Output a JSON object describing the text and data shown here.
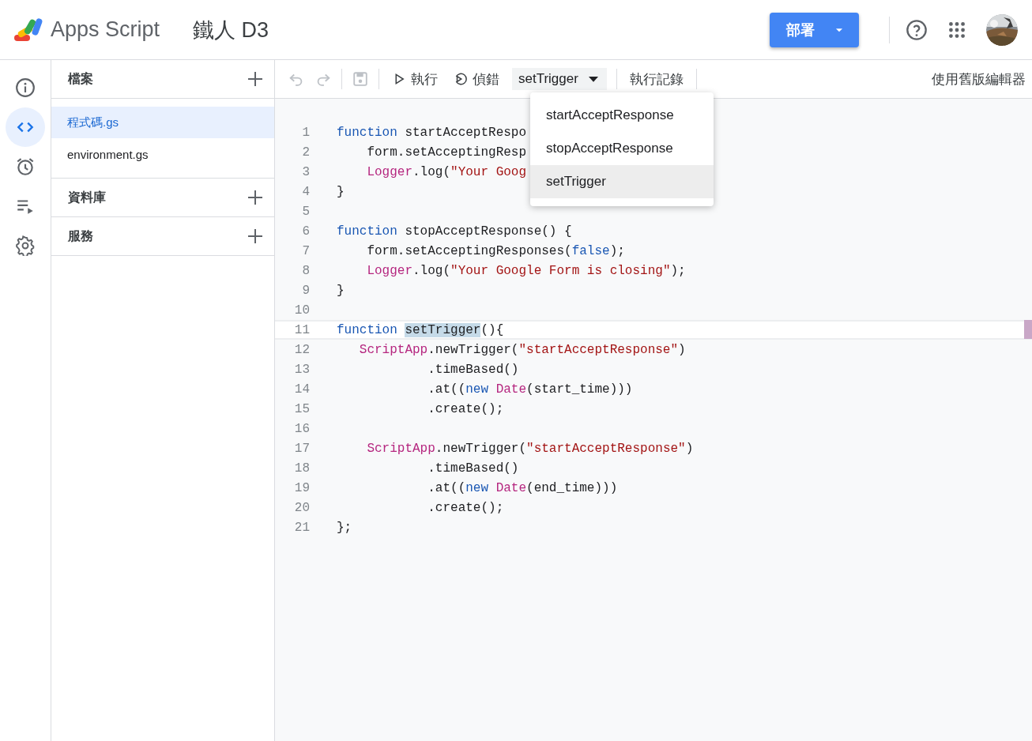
{
  "header": {
    "app_name": "Apps Script",
    "project_title": "鐵人 D3",
    "deploy_button": "部署"
  },
  "rail": [
    {
      "kind": "info",
      "selected": false
    },
    {
      "kind": "code",
      "selected": true
    },
    {
      "kind": "clock",
      "selected": false
    },
    {
      "kind": "executions",
      "selected": false
    },
    {
      "kind": "settings",
      "selected": false
    }
  ],
  "files_panel": [
    {
      "title": "檔案",
      "files": [
        {
          "name": "程式碼.gs",
          "selected": true
        },
        {
          "name": "environment.gs",
          "selected": false
        }
      ]
    },
    {
      "title": "資料庫"
    },
    {
      "title": "服務"
    }
  ],
  "toolbar": {
    "run": "執行",
    "debug": "偵錯",
    "function_select": "setTrigger",
    "log": "執行記錄",
    "legacy_editor": "使用舊版編輯器"
  },
  "function_menu": [
    {
      "label": "startAcceptResponse",
      "selected": false
    },
    {
      "label": "stopAcceptResponse",
      "selected": false
    },
    {
      "label": "setTrigger",
      "selected": true
    }
  ],
  "editor": {
    "lines": [
      {
        "number": "1",
        "current": false,
        "tokens": [
          {
            "kind": "keyword",
            "text": "function"
          },
          {
            "kind": "plain",
            "text": " startAcceptRespo"
          }
        ]
      },
      {
        "number": "2",
        "current": false,
        "tokens": [
          {
            "kind": "plain",
            "text": "    form.setAcceptingResp"
          }
        ]
      },
      {
        "number": "3",
        "current": false,
        "tokens": [
          {
            "kind": "type",
            "text": "    Logger"
          },
          {
            "kind": "plain",
            "text": ".log("
          },
          {
            "kind": "string",
            "text": "\"Your Goog"
          }
        ]
      },
      {
        "number": "4",
        "current": false,
        "tokens": [
          {
            "kind": "plain",
            "text": "}"
          }
        ]
      },
      {
        "number": "5",
        "current": false
      },
      {
        "number": "6",
        "current": false,
        "tokens": [
          {
            "kind": "keyword",
            "text": "function"
          },
          {
            "kind": "plain",
            "text": " stopAcceptResponse() {"
          }
        ]
      },
      {
        "number": "7",
        "current": false,
        "tokens": [
          {
            "kind": "plain",
            "text": "    form.setAcceptingResponses("
          },
          {
            "kind": "keyword",
            "text": "false"
          },
          {
            "kind": "plain",
            "text": ");"
          }
        ]
      },
      {
        "number": "8",
        "current": false,
        "tokens": [
          {
            "kind": "type",
            "text": "    Logger"
          },
          {
            "kind": "plain",
            "text": ".log("
          },
          {
            "kind": "string",
            "text": "\"Your Google Form is closing\""
          },
          {
            "kind": "plain",
            "text": ");"
          }
        ]
      },
      {
        "number": "9",
        "current": false,
        "tokens": [
          {
            "kind": "plain",
            "text": "}"
          }
        ]
      },
      {
        "number": "10",
        "current": false
      },
      {
        "number": "11",
        "current": true,
        "tokens": [
          {
            "kind": "keyword",
            "text": "function "
          },
          {
            "kind": "match",
            "text": "setTrigger"
          },
          {
            "kind": "plain",
            "text": "(){"
          }
        ]
      },
      {
        "number": "12",
        "current": false,
        "tokens": [
          {
            "kind": "type",
            "text": "   ScriptApp"
          },
          {
            "kind": "plain",
            "text": ".newTrigger("
          },
          {
            "kind": "string",
            "text": "\"startAcceptResponse\""
          },
          {
            "kind": "plain",
            "text": ")"
          }
        ]
      },
      {
        "number": "13",
        "current": false,
        "tokens": [
          {
            "kind": "plain",
            "text": "            .timeBased()"
          }
        ]
      },
      {
        "number": "14",
        "current": false,
        "tokens": [
          {
            "kind": "plain",
            "text": "            .at(("
          },
          {
            "kind": "keyword",
            "text": "new "
          },
          {
            "kind": "type",
            "text": "Date"
          },
          {
            "kind": "plain",
            "text": "(start_time)))"
          }
        ]
      },
      {
        "number": "15",
        "current": false,
        "tokens": [
          {
            "kind": "plain",
            "text": "            .create();"
          }
        ]
      },
      {
        "number": "16",
        "current": false
      },
      {
        "number": "17",
        "current": false,
        "tokens": [
          {
            "kind": "type",
            "text": "    ScriptApp"
          },
          {
            "kind": "plain",
            "text": ".newTrigger("
          },
          {
            "kind": "string",
            "text": "\"startAcceptResponse\""
          },
          {
            "kind": "plain",
            "text": ")"
          }
        ]
      },
      {
        "number": "18",
        "current": false,
        "tokens": [
          {
            "kind": "plain",
            "text": "            .timeBased()"
          }
        ]
      },
      {
        "number": "19",
        "current": false,
        "tokens": [
          {
            "kind": "plain",
            "text": "            .at(("
          },
          {
            "kind": "keyword",
            "text": "new "
          },
          {
            "kind": "type",
            "text": "Date"
          },
          {
            "kind": "plain",
            "text": "(end_time)))"
          }
        ]
      },
      {
        "number": "20",
        "current": false,
        "tokens": [
          {
            "kind": "plain",
            "text": "            .create();"
          }
        ]
      },
      {
        "number": "21",
        "current": false,
        "tokens": [
          {
            "kind": "plain",
            "text": "};"
          }
        ]
      }
    ]
  }
}
